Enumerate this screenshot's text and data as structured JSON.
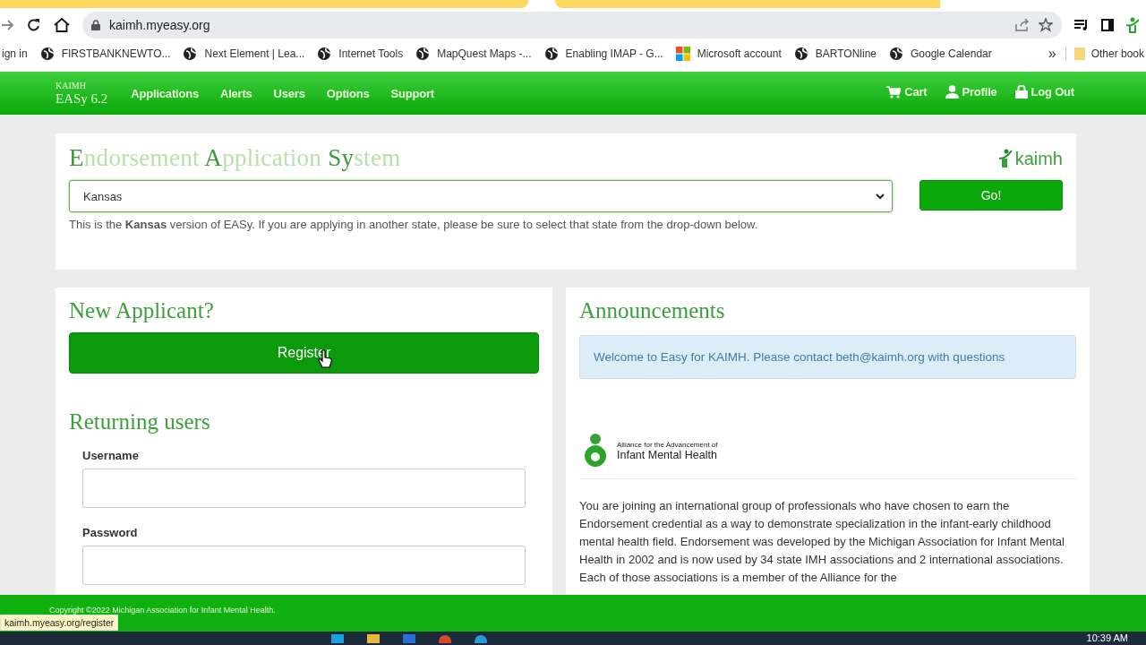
{
  "browser": {
    "url": "kaimh.myeasy.org",
    "bookmarks": [
      {
        "label": "ign in",
        "kind": "plain"
      },
      {
        "label": "FIRSTBANKNEWTO...",
        "kind": "globe"
      },
      {
        "label": "Next Element | Lea...",
        "kind": "globe"
      },
      {
        "label": "Internet Tools",
        "kind": "globe"
      },
      {
        "label": "MapQuest Maps -...",
        "kind": "globe"
      },
      {
        "label": "Enabling IMAP - G...",
        "kind": "globe"
      },
      {
        "label": "Microsoft account",
        "kind": "windows"
      },
      {
        "label": "BARTONline",
        "kind": "globe"
      },
      {
        "label": "Google Calendar",
        "kind": "globe"
      }
    ],
    "overflow": "»",
    "other": "Other book"
  },
  "nav": {
    "brand_top": "KAIMH",
    "brand": "EASy 6.2",
    "items": [
      "Applications",
      "Alerts",
      "Users",
      "Options",
      "Support"
    ],
    "actions": [
      {
        "label": "Cart",
        "kind": "cart"
      },
      {
        "label": "Profile",
        "kind": "person"
      },
      {
        "label": "Log Out",
        "kind": "lock"
      }
    ]
  },
  "system": {
    "title": "**E**ndorsement **A**pplication **Sy**stem",
    "logo": "kaimh",
    "state": "Kansas",
    "go": "Go!",
    "note": "This is the **Kansas** version of EASy. If you are applying in another state, please be sure to select that state from the drop-down below."
  },
  "new_applicant": {
    "heading": "New Applicant?",
    "button": "Register"
  },
  "returning": {
    "heading": "Returning users",
    "fields": [
      {
        "label": "Username"
      },
      {
        "label": "Password"
      }
    ]
  },
  "announcements": {
    "heading": "Announcements",
    "alert": "Welcome to Easy for KAIMH. Please contact beth@kaimh.org with questions",
    "logo_line1": "Alliance for the Advancement of",
    "logo_line2": "Infant Mental Health",
    "body": "You are joining an international group of professionals who have chosen to earn the Endorsement credential as a way to demonstrate specialization in the infant-early childhood mental health field. Endorsement was developed by the Michigan Association for Infant Mental Health in 2002 and is now used by 34 state IMH associations and 2 international associations. Each of those associations is a member of the Alliance for the"
  },
  "footer": "Copyright ©2022 Michigan Association for Infant Mental Health.",
  "status_url": "kaimh.myeasy.org/register",
  "taskbar": {
    "time": "10:39 AM"
  }
}
